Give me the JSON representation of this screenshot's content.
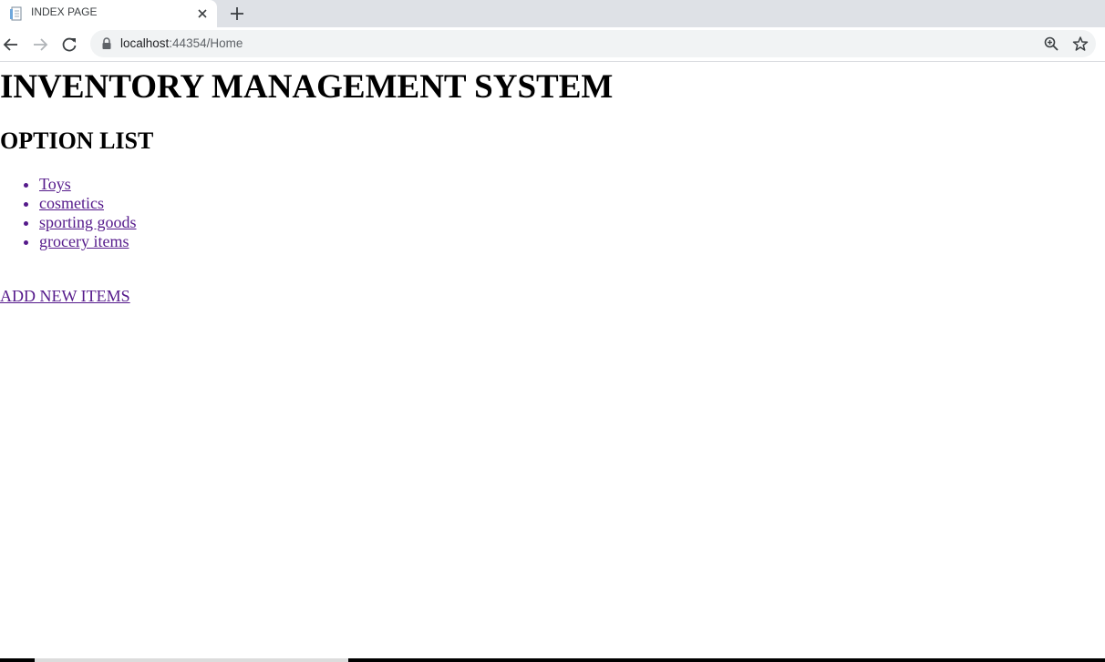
{
  "tab": {
    "title": "INDEX PAGE",
    "favicon": "document-icon"
  },
  "toolbar": {
    "url_host": "localhost",
    "url_path": ":44354/Home"
  },
  "page": {
    "title": "INVENTORY MANAGEMENT SYSTEM",
    "section_title": "OPTION LIST",
    "options": [
      {
        "label": "Toys"
      },
      {
        "label": "cosmetics"
      },
      {
        "label": "sporting goods"
      },
      {
        "label": "grocery items"
      }
    ],
    "add_link": "ADD NEW ITEMS"
  },
  "colors": {
    "visited_link": "#551a8b",
    "tabstrip_bg": "#dee1e6",
    "omnibox_bg": "#f1f3f4"
  }
}
